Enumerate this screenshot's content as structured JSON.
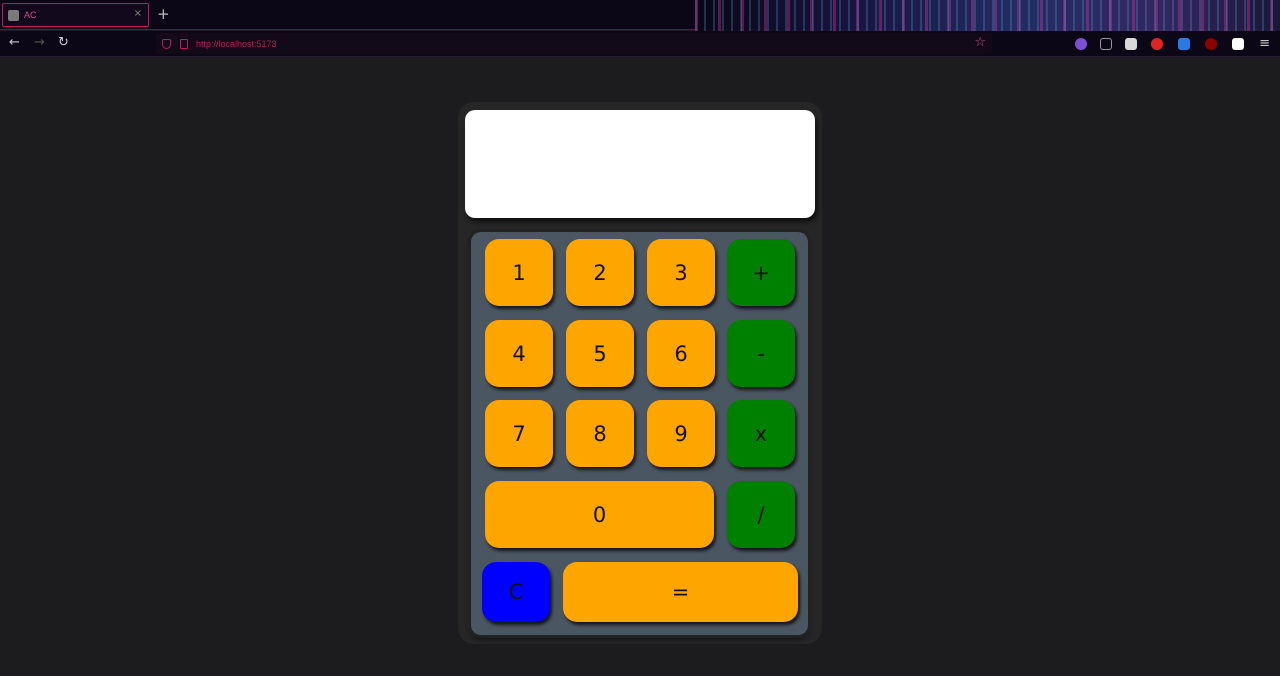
{
  "browser": {
    "tab_title": "AC",
    "tab_close": "×",
    "new_tab": "+",
    "url": "http://localhost:5173",
    "back_icon": "←",
    "forward_icon": "→",
    "reload_icon": "↻",
    "star_icon": "☆",
    "menu_icon": "≡"
  },
  "calculator": {
    "display_value": "",
    "keys": {
      "k1": "1",
      "k2": "2",
      "k3": "3",
      "plus": "+",
      "k4": "4",
      "k5": "5",
      "k6": "6",
      "minus": "-",
      "k7": "7",
      "k8": "8",
      "k9": "9",
      "multiply": "x",
      "k0": "0",
      "divide": "/",
      "clear": "C",
      "equals": "="
    },
    "colors": {
      "number_key": "#ffa500",
      "operator_key": "#008000",
      "clear_key": "#0000ff",
      "display": "#ffffff",
      "keypad": "#4b5663"
    }
  }
}
